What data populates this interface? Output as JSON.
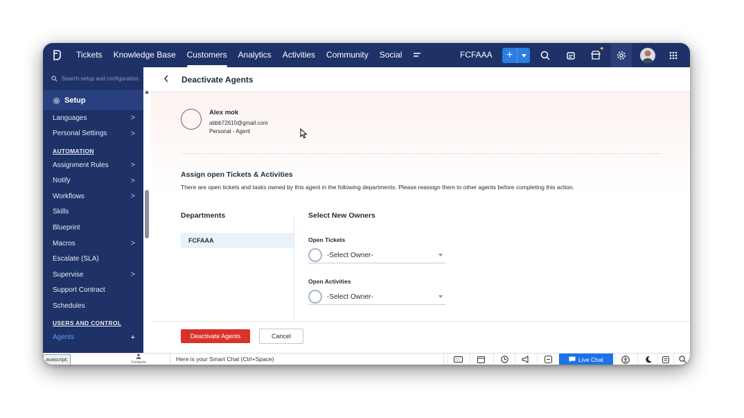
{
  "topbar": {
    "nav": [
      "Tickets",
      "Knowledge Base",
      "Customers",
      "Analytics",
      "Activities",
      "Community",
      "Social"
    ],
    "active_nav": "Customers",
    "org": "FCFAAA"
  },
  "sidebar": {
    "search_placeholder": "Search setup and configuration.",
    "setup_label": "Setup",
    "items": [
      {
        "label": "Languages",
        "chevron": ">"
      },
      {
        "label": "Personal Settings",
        "chevron": ">"
      },
      {
        "section": "AUTOMATION"
      },
      {
        "label": "Assignment Rules",
        "chevron": ">"
      },
      {
        "label": "Notify",
        "chevron": ">"
      },
      {
        "label": "Workflows",
        "chevron": ">"
      },
      {
        "label": "Skills"
      },
      {
        "label": "Blueprint"
      },
      {
        "label": "Macros",
        "chevron": ">"
      },
      {
        "label": "Escalate (SLA)"
      },
      {
        "label": "Supervise",
        "chevron": ">"
      },
      {
        "label": "Support Contract"
      },
      {
        "label": "Schedules"
      },
      {
        "section": "USERS AND CONTROL"
      },
      {
        "label": "Agents",
        "chevron": "+",
        "active": true
      }
    ]
  },
  "page": {
    "title": "Deactivate Agents",
    "agent": {
      "name": "Alex mok",
      "email": "abbb72610@gmail.com",
      "role": "Personal - Agent"
    },
    "assign_title": "Assign open Tickets & Activities",
    "assign_desc": "There are open tickets and tasks owned by this agent in the following departments. Please reassign them to other agents before completing this action.",
    "departments_heading": "Departments",
    "owners_heading": "Select New Owners",
    "department": "FCFAAA",
    "open_tickets_label": "Open Tickets",
    "open_tickets_value": "-Select Owner-",
    "open_activities_label": "Open Activities",
    "open_activities_value": "-Select Owner-",
    "deactivate_button": "Deactivate Agents",
    "cancel_button": "Cancel"
  },
  "bottombar": {
    "status_tip": "avascript;",
    "contacts_label": "Contacts",
    "smart_chat": "Here is your Smart Chat (Ctrl+Space)",
    "live_chat": "Live Chat"
  },
  "colors": {
    "navy": "#1e3267",
    "accent_blue": "#2a7de1",
    "danger": "#d8322a",
    "live_chat": "#1a73e8"
  }
}
